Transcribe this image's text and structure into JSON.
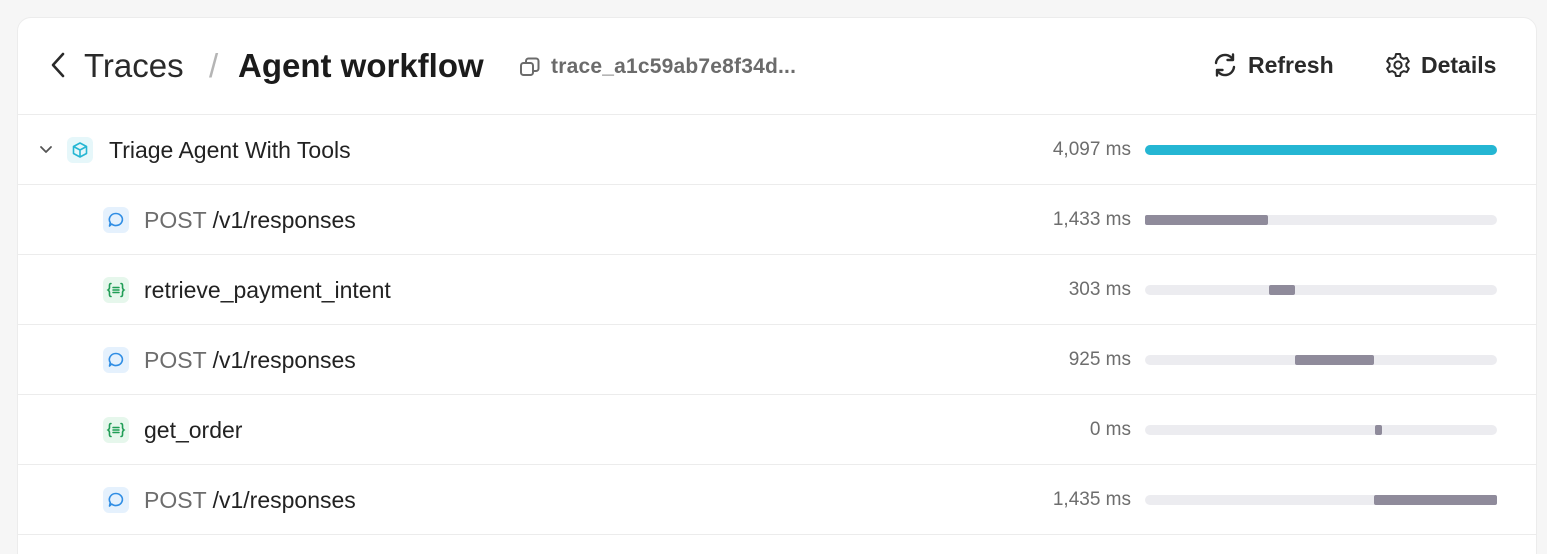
{
  "header": {
    "breadcrumb_root": "Traces",
    "breadcrumb_separator": "/",
    "title": "Agent workflow",
    "trace_id": "trace_a1c59ab7e8f34d...",
    "refresh_label": "Refresh",
    "details_label": "Details"
  },
  "colors": {
    "agent_bar": "#25b6d3",
    "span_bar": "#8f8b9b",
    "track": "#ececf0",
    "agent_icon": "#25b6d3",
    "response_icon": "#2f8de4",
    "function_icon": "#1f9d55"
  },
  "spans": [
    {
      "kind": "agent",
      "icon": "cube-icon",
      "method": "",
      "label": "Triage Agent With Tools",
      "duration": "4,097 ms",
      "bar_start": 0.0,
      "bar_fraction": 1.0,
      "expanded": true
    },
    {
      "kind": "response",
      "icon": "chat-bubble-icon",
      "method": "POST",
      "label": "/v1/responses",
      "duration": "1,433 ms",
      "bar_start": 0.0,
      "bar_fraction": 0.35
    },
    {
      "kind": "function",
      "icon": "function-braces-icon",
      "method": "",
      "label": "retrieve_payment_intent",
      "duration": "303 ms",
      "bar_start": 0.353,
      "bar_fraction": 0.074
    },
    {
      "kind": "response",
      "icon": "chat-bubble-icon",
      "method": "POST",
      "label": "/v1/responses",
      "duration": "925 ms",
      "bar_start": 0.426,
      "bar_fraction": 0.226
    },
    {
      "kind": "function",
      "icon": "function-braces-icon",
      "method": "",
      "label": "get_order",
      "duration": "0 ms",
      "bar_start": 0.652,
      "bar_fraction": 0.02
    },
    {
      "kind": "response",
      "icon": "chat-bubble-icon",
      "method": "POST",
      "label": "/v1/responses",
      "duration": "1,435 ms",
      "bar_start": 0.65,
      "bar_fraction": 0.35
    }
  ]
}
